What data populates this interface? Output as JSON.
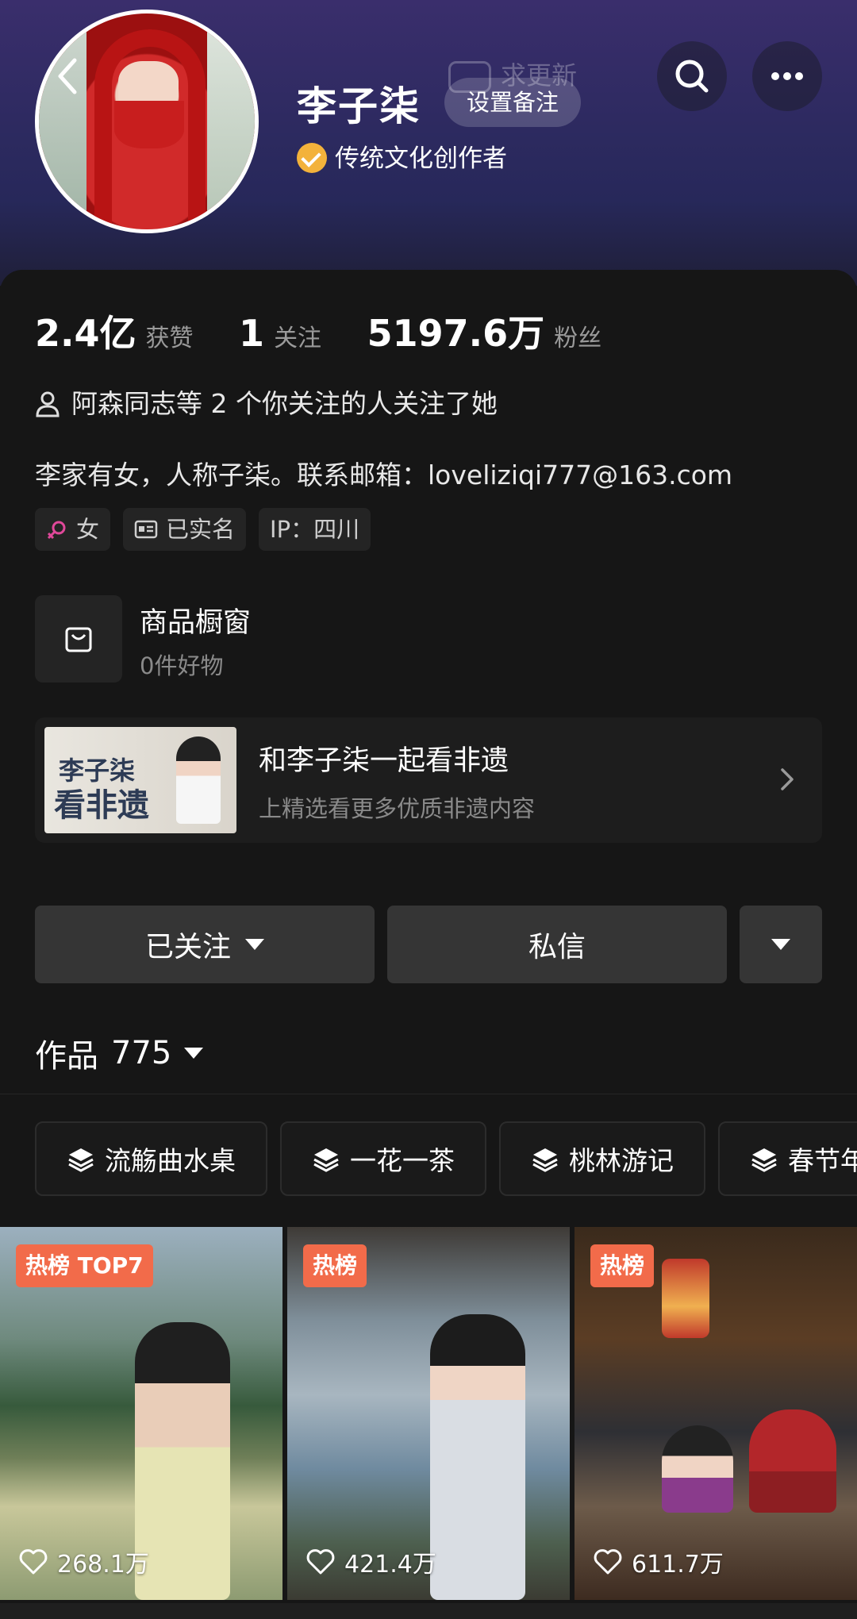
{
  "profile": {
    "name": "李子柒",
    "remark_label": "设置备注",
    "ask_update_label": "求更新",
    "verified_title": "传统文化创作者",
    "stats": {
      "likes_value": "2.4亿",
      "likes_label": "获赞",
      "following_value": "1",
      "following_label": "关注",
      "followers_value": "5197.6万",
      "followers_label": "粉丝"
    },
    "mutual_text": "阿森同志等 2 个你关注的人关注了她",
    "bio": "李家有女，人称子柒。联系邮箱：loveliziqi777@163.com",
    "tags": {
      "gender": "女",
      "verified": "已实名",
      "ip": "IP：四川"
    }
  },
  "shop": {
    "title": "商品橱窗",
    "subtitle": "0件好物"
  },
  "banner": {
    "title": "和李子柒一起看非遗",
    "subtitle": "上精选看更多优质非遗内容",
    "image_text_1": "李子柒",
    "image_text_2": "看非遗"
  },
  "actions": {
    "follow_label": "已关注",
    "message_label": "私信"
  },
  "works": {
    "label": "作品",
    "count": "775"
  },
  "collections": [
    "流觞曲水桌",
    "一花一茶",
    "桃林游记",
    "春节年"
  ],
  "videos": [
    {
      "badge": "热榜 TOP7",
      "likes": "268.1万"
    },
    {
      "badge": "热榜",
      "likes": "421.4万"
    },
    {
      "badge": "热榜",
      "likes": "611.7万"
    }
  ],
  "colors": {
    "accent_hot": "#f26b4a",
    "verified_badge": "#f3b23b",
    "gender_female": "#e0489a"
  },
  "icons": [
    "back-icon",
    "search-icon",
    "more-icon",
    "verified-icon",
    "user-icon",
    "female-icon",
    "id-card-icon",
    "bag-icon",
    "chevron-right-icon",
    "stack-icon",
    "heart-icon"
  ]
}
